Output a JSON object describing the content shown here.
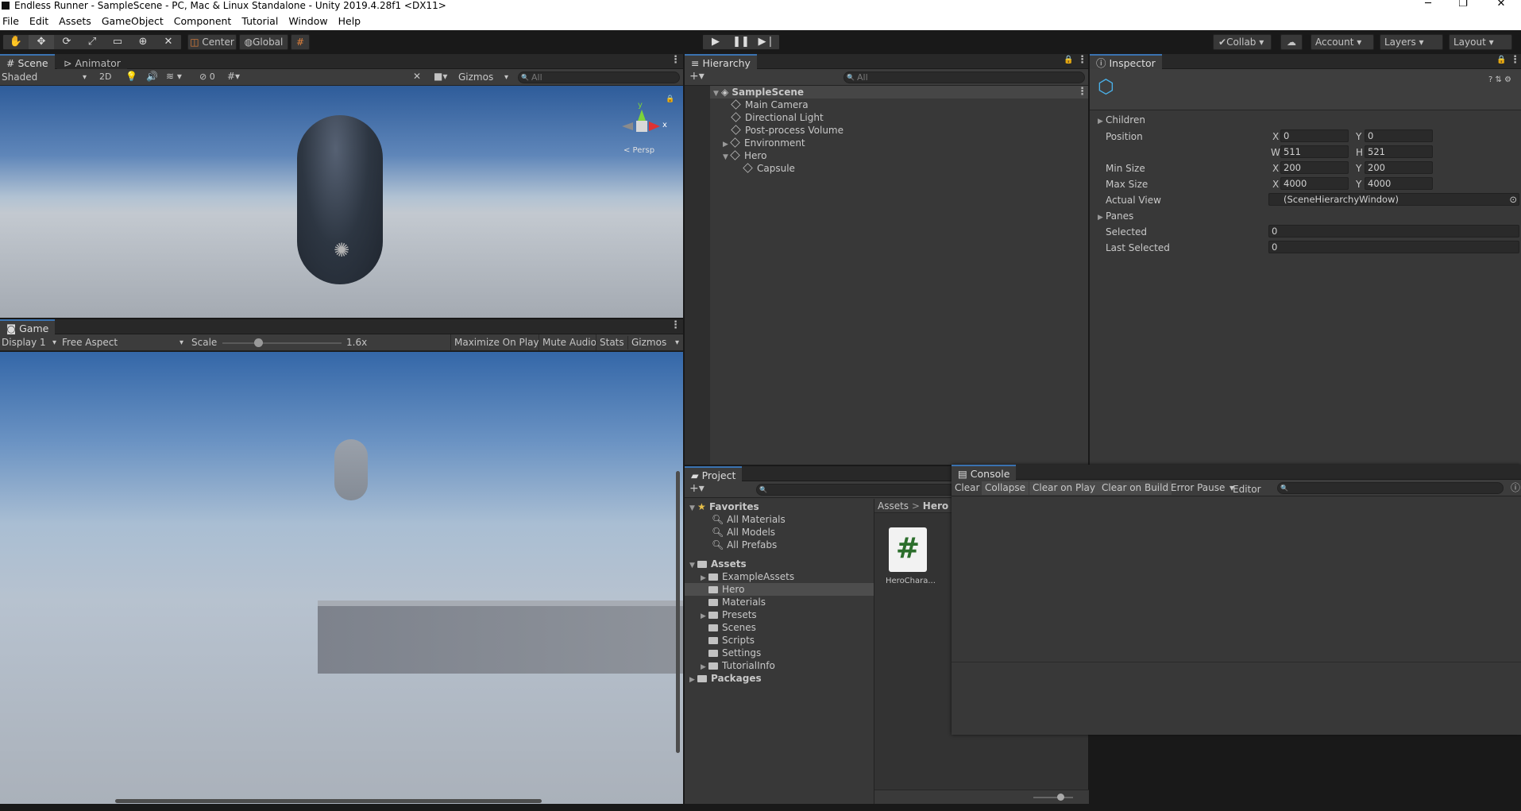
{
  "window": {
    "title": "Endless Runner - SampleScene - PC, Mac & Linux Standalone - Unity 2019.4.28f1 <DX11>",
    "minimize": "─",
    "maximize": "❐",
    "close": "✕"
  },
  "menu": [
    "File",
    "Edit",
    "Assets",
    "GameObject",
    "Component",
    "Tutorial",
    "Window",
    "Help"
  ],
  "toolbar": {
    "pivot": "Center",
    "space": "Global",
    "collab": "Collab",
    "account": "Account",
    "layers": "Layers",
    "layout": "Layout"
  },
  "scene": {
    "tab": "Scene",
    "tab2": "Animator",
    "shading": "Shaded",
    "mode2d": "2D",
    "fx_count": "0",
    "gizmos": "Gizmos",
    "search_placeholder": "All",
    "axis_y": "y",
    "axis_x": "x",
    "persp": "< Persp"
  },
  "game": {
    "tab": "Game",
    "display": "Display 1",
    "aspect": "Free Aspect",
    "scale_label": "Scale",
    "scale_value": "1.6x",
    "scale_level": 0.3,
    "maximize": "Maximize On Play",
    "mute": "Mute Audio",
    "stats": "Stats",
    "gizmos": "Gizmos"
  },
  "hierarchy": {
    "tab": "Hierarchy",
    "search_placeholder": "All",
    "scene": "SampleScene",
    "items": [
      "Main Camera",
      "Directional Light",
      "Post-process Volume",
      "Environment",
      "Hero",
      "Capsule"
    ]
  },
  "inspector": {
    "tab": "Inspector",
    "rows": {
      "children": "Children",
      "position": "Position",
      "min_size": "Min Size",
      "max_size": "Max Size",
      "actual_view": "Actual View",
      "panes": "Panes",
      "selected": "Selected",
      "last_selected": "Last Selected"
    },
    "fields": {
      "pos_x": "0",
      "pos_y": "0",
      "w": "511",
      "h": "521",
      "min_x": "200",
      "min_y": "200",
      "max_x": "4000",
      "max_y": "4000",
      "actual_view": "(SceneHierarchyWindow)",
      "selected": "0",
      "last_selected": "0"
    },
    "labels": {
      "x": "X",
      "y": "Y",
      "w": "W",
      "h": "H"
    }
  },
  "project": {
    "tab": "Project",
    "favorites": "Favorites",
    "fav_items": [
      "All Materials",
      "All Models",
      "All Prefabs"
    ],
    "assets": "Assets",
    "asset_folders": [
      "ExampleAssets",
      "Hero",
      "Materials",
      "Presets",
      "Scenes",
      "Scripts",
      "Settings",
      "TutorialInfo"
    ],
    "packages": "Packages",
    "breadcrumb_root": "Assets",
    "breadcrumb_sep": ">",
    "breadcrumb_current": "Hero",
    "file_name": "HeroChara...",
    "file_icon": "#"
  },
  "console": {
    "tab": "Console",
    "buttons": [
      "Clear",
      "Collapse",
      "Clear on Play",
      "Clear on Build",
      "Error Pause",
      "Editor"
    ]
  },
  "colors": {
    "accent": "#3a72b0",
    "panel": "#383838",
    "sky_top": "#3b6aa5",
    "ground": "#9aa0a8"
  }
}
